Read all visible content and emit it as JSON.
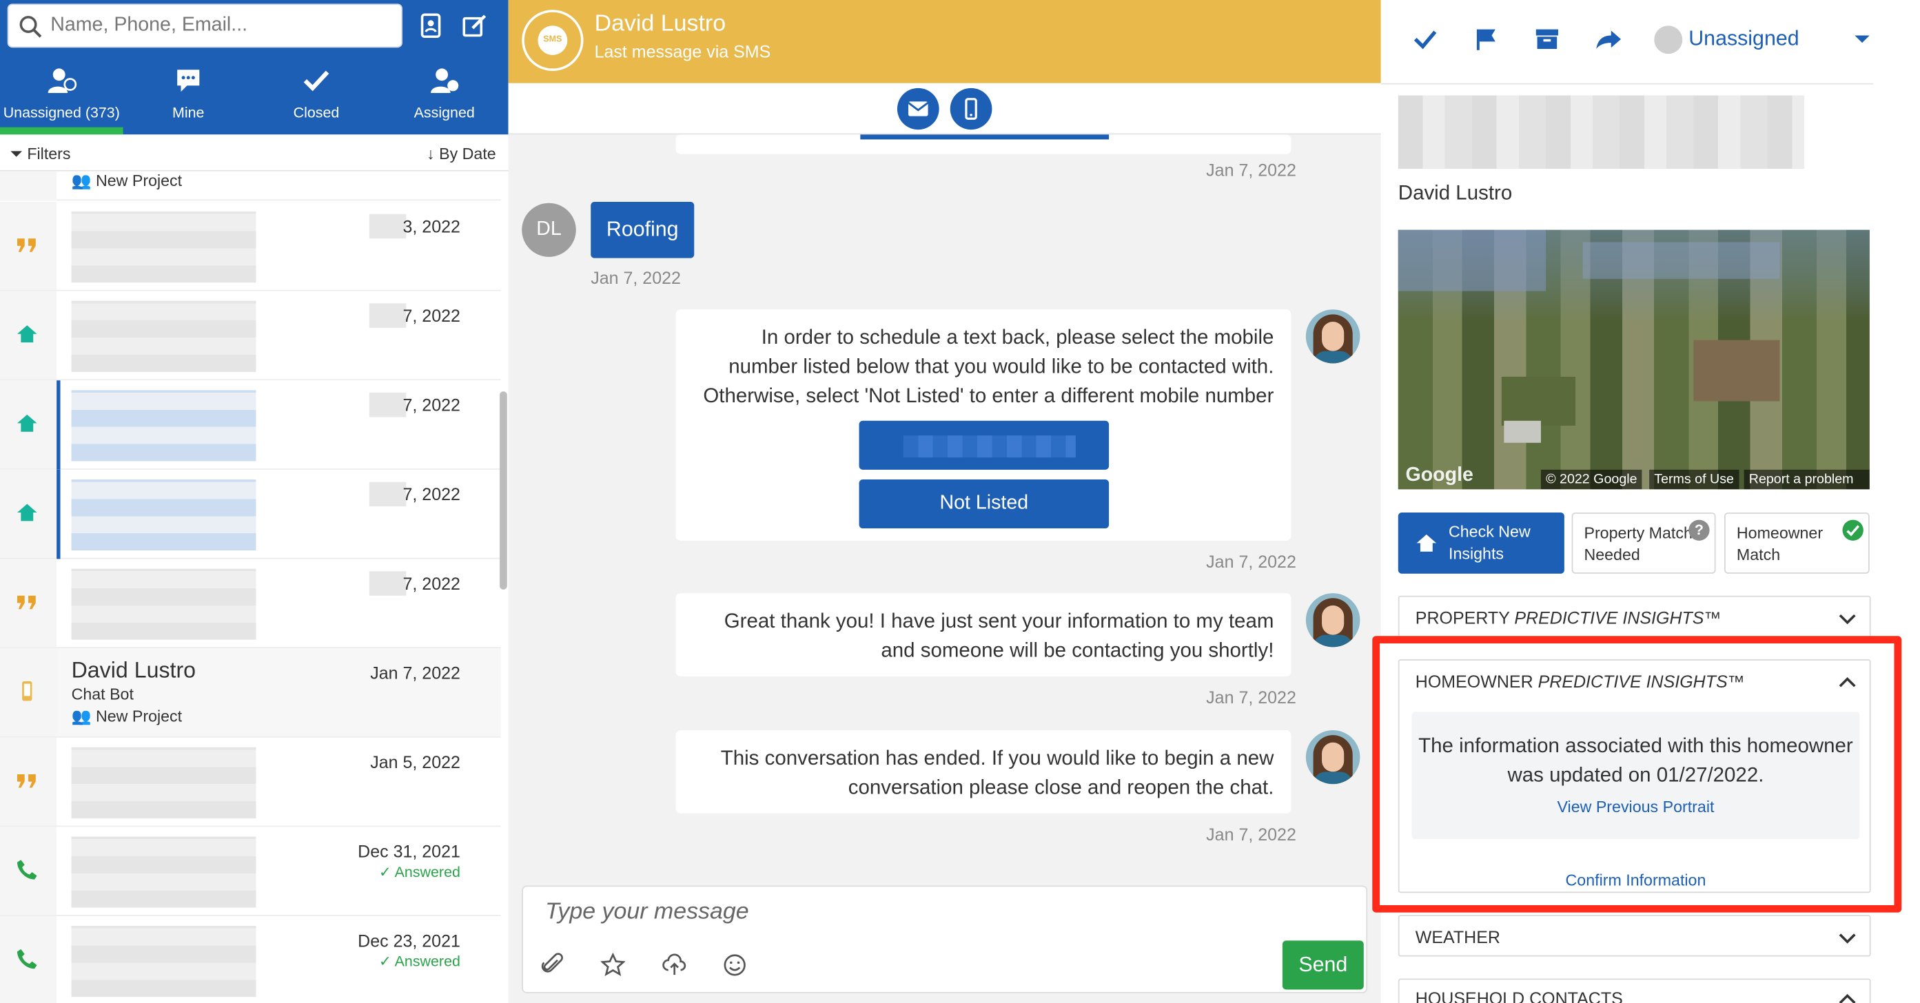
{
  "search": {
    "placeholder": "Name, Phone, Email..."
  },
  "nav_tabs": [
    {
      "label": "Unassigned (373)",
      "icon": "user-add-icon",
      "active": true
    },
    {
      "label": "Mine",
      "icon": "chat-bubble-icon"
    },
    {
      "label": "Closed",
      "icon": "check-icon"
    },
    {
      "label": "Assigned",
      "icon": "user-check-icon"
    }
  ],
  "filters": {
    "label": "Filters",
    "sort": "By Date"
  },
  "conversations": {
    "top_item_label": "New Project",
    "items": [
      {
        "date": "3, 2022",
        "icon": "quote-icon",
        "answered": ""
      },
      {
        "date": "7, 2022",
        "icon": "home-icon",
        "answered": ""
      },
      {
        "date": "7, 2022",
        "icon": "home-icon",
        "answered": ""
      },
      {
        "date": "7, 2022",
        "icon": "home-icon",
        "answered": ""
      },
      {
        "date": "7, 2022",
        "icon": "quote-icon",
        "answered": ""
      },
      {
        "name": "David Lustro",
        "sub": "Chat Bot",
        "project": "New Project",
        "date": "Jan 7, 2022",
        "icon": "mobile-icon"
      },
      {
        "date": "Jan 5, 2022",
        "icon": "quote-icon",
        "answered": ""
      },
      {
        "date": "Dec 31, 2021",
        "icon": "phone-icon",
        "answered": "Answered"
      },
      {
        "date": "Dec 23, 2021",
        "icon": "phone-icon",
        "answered": "Answered"
      }
    ]
  },
  "chat_header": {
    "badge": "SMS",
    "name": "David Lustro",
    "subtitle": "Last message via SMS"
  },
  "messages": {
    "stamp_top": "Jan 7, 2022",
    "user_initials": "DL",
    "user_reply": "Roofing",
    "user_stamp": "Jan 7, 2022",
    "bot_1": {
      "text": "In order to schedule a text back, please select the mobile number listed below that you would like to be contacted with. Otherwise, select 'Not Listed' to enter a different mobile number",
      "option_not_listed": "Not Listed",
      "stamp": "Jan 7, 2022"
    },
    "bot_2": {
      "text": "Great thank you! I have just sent your information to my team and someone will be contacting you shortly!",
      "stamp": "Jan 7, 2022"
    },
    "bot_3": {
      "text": "This conversation has ended. If you would like to begin a new conversation please close and reopen the chat.",
      "stamp": "Jan 7, 2022"
    }
  },
  "composer": {
    "placeholder": "Type your message",
    "send_label": "Send"
  },
  "right": {
    "assignee": "Unassigned",
    "contact_name": "David Lustro",
    "map": {
      "google": "Google",
      "copyright": "© 2022 Google",
      "terms": "Terms of Use",
      "report": "Report a problem"
    },
    "insight_buttons": {
      "check_new": "Check New Insights",
      "property_match": "Property Match Needed",
      "homeowner_match": "Homeowner Match"
    },
    "property_section": {
      "prefix": "PROPERTY ",
      "italic": "PREDICTIVE INSIGHTS™"
    },
    "homeowner_section": {
      "prefix": "HOMEOWNER ",
      "italic": "PREDICTIVE INSIGHTS™",
      "message": "The information associated with this homeowner was updated on 01/27/2022.",
      "view_previous": "View Previous Portrait",
      "confirm": "Confirm Information"
    },
    "weather_section": "WEATHER",
    "household_section": "HOUSEHOLD CONTACTS"
  },
  "colors": {
    "brand_blue": "#1c5fb5",
    "header_yellow": "#e9b94c",
    "success_green": "#2aa34a",
    "highlight_red": "#ff2a1a"
  }
}
